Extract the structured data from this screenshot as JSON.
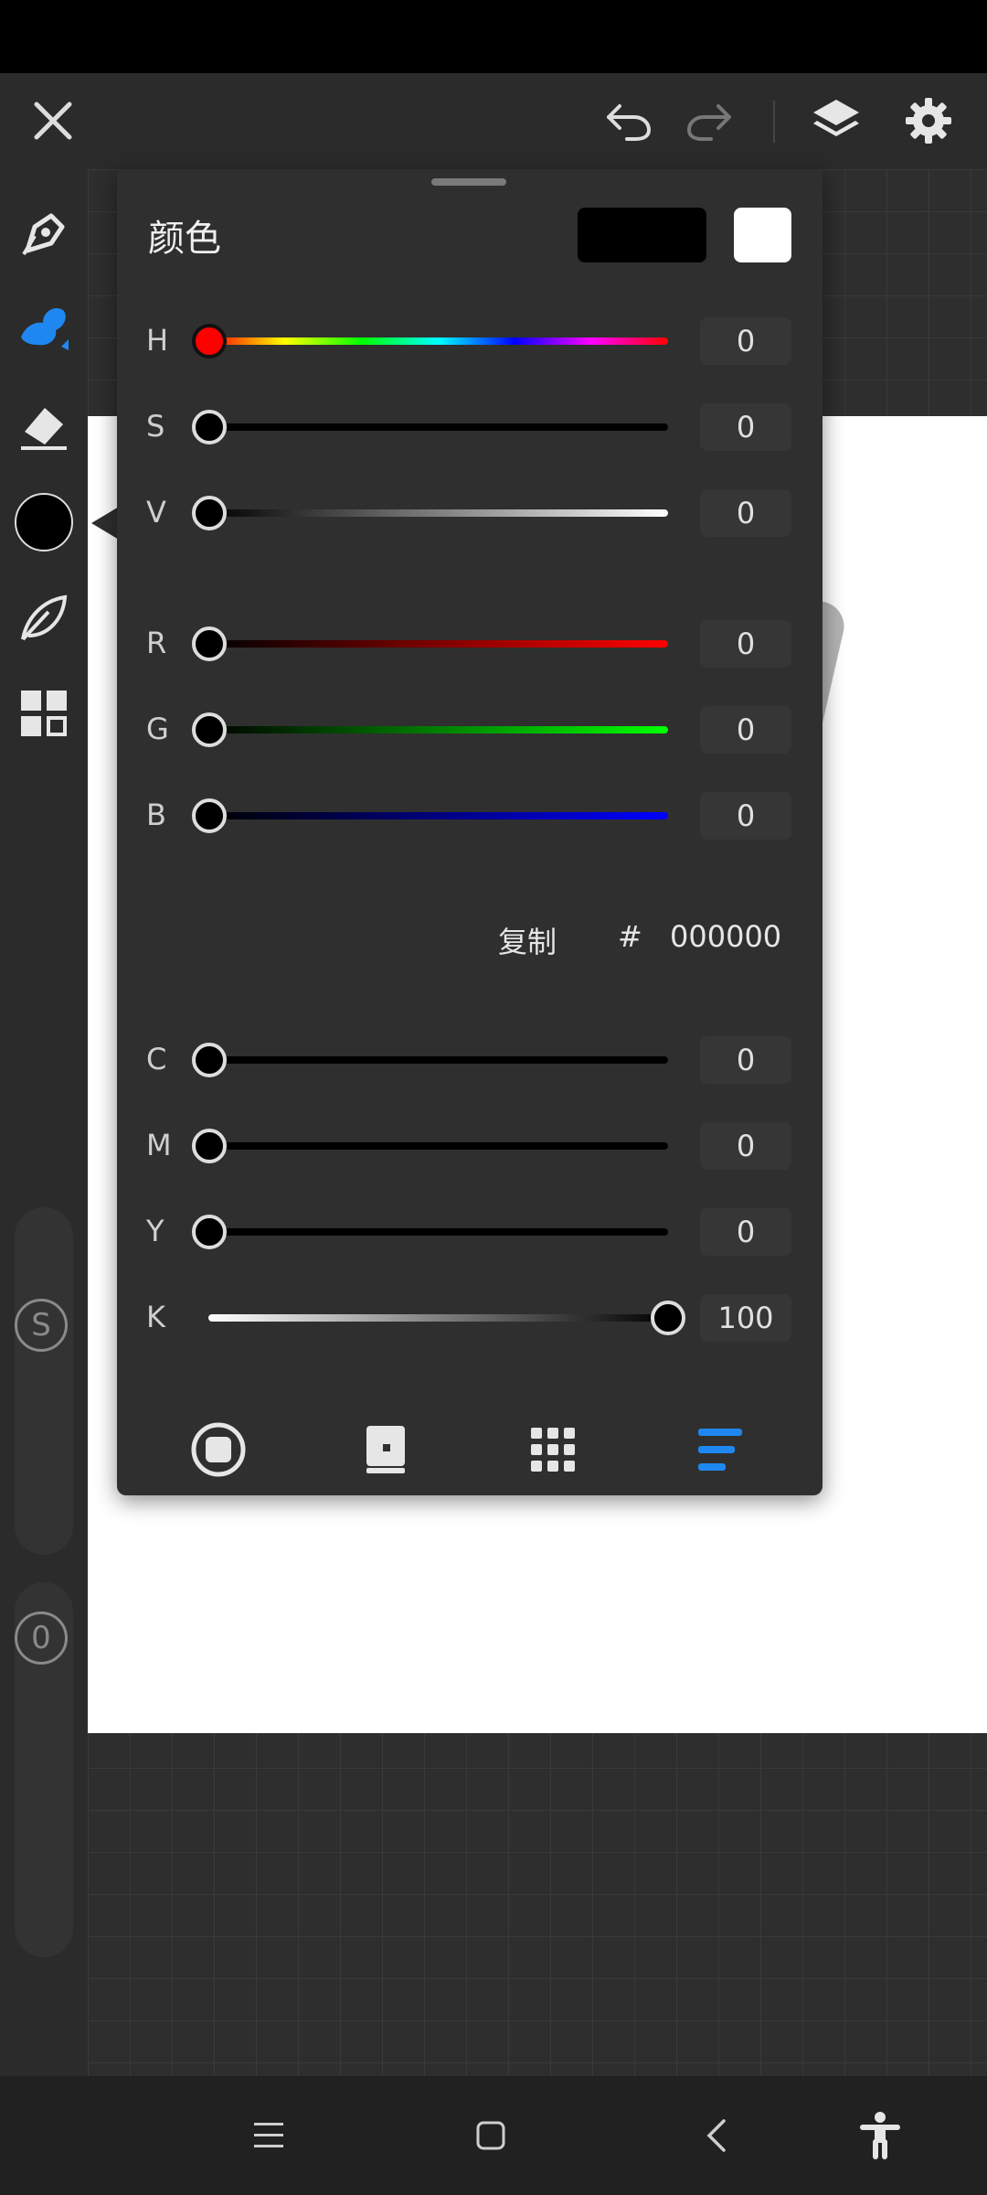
{
  "panel": {
    "title": "颜色",
    "hsv": [
      {
        "label": "H",
        "value": "0"
      },
      {
        "label": "S",
        "value": "0"
      },
      {
        "label": "V",
        "value": "0"
      }
    ],
    "rgb": [
      {
        "label": "R",
        "value": "0"
      },
      {
        "label": "G",
        "value": "0"
      },
      {
        "label": "B",
        "value": "0"
      }
    ],
    "hex": {
      "copy_label": "复制",
      "hash": "#",
      "value": "000000"
    },
    "cmyk": [
      {
        "label": "C",
        "value": "0"
      },
      {
        "label": "M",
        "value": "0"
      },
      {
        "label": "Y",
        "value": "0"
      },
      {
        "label": "K",
        "value": "100"
      }
    ],
    "selected_mode": "sliders"
  },
  "sidebar": {
    "size_badge": "S",
    "opacity_badge": "0"
  },
  "colors": {
    "primary": "#000000",
    "secondary": "#ffffff",
    "accent": "#1e88f0"
  }
}
